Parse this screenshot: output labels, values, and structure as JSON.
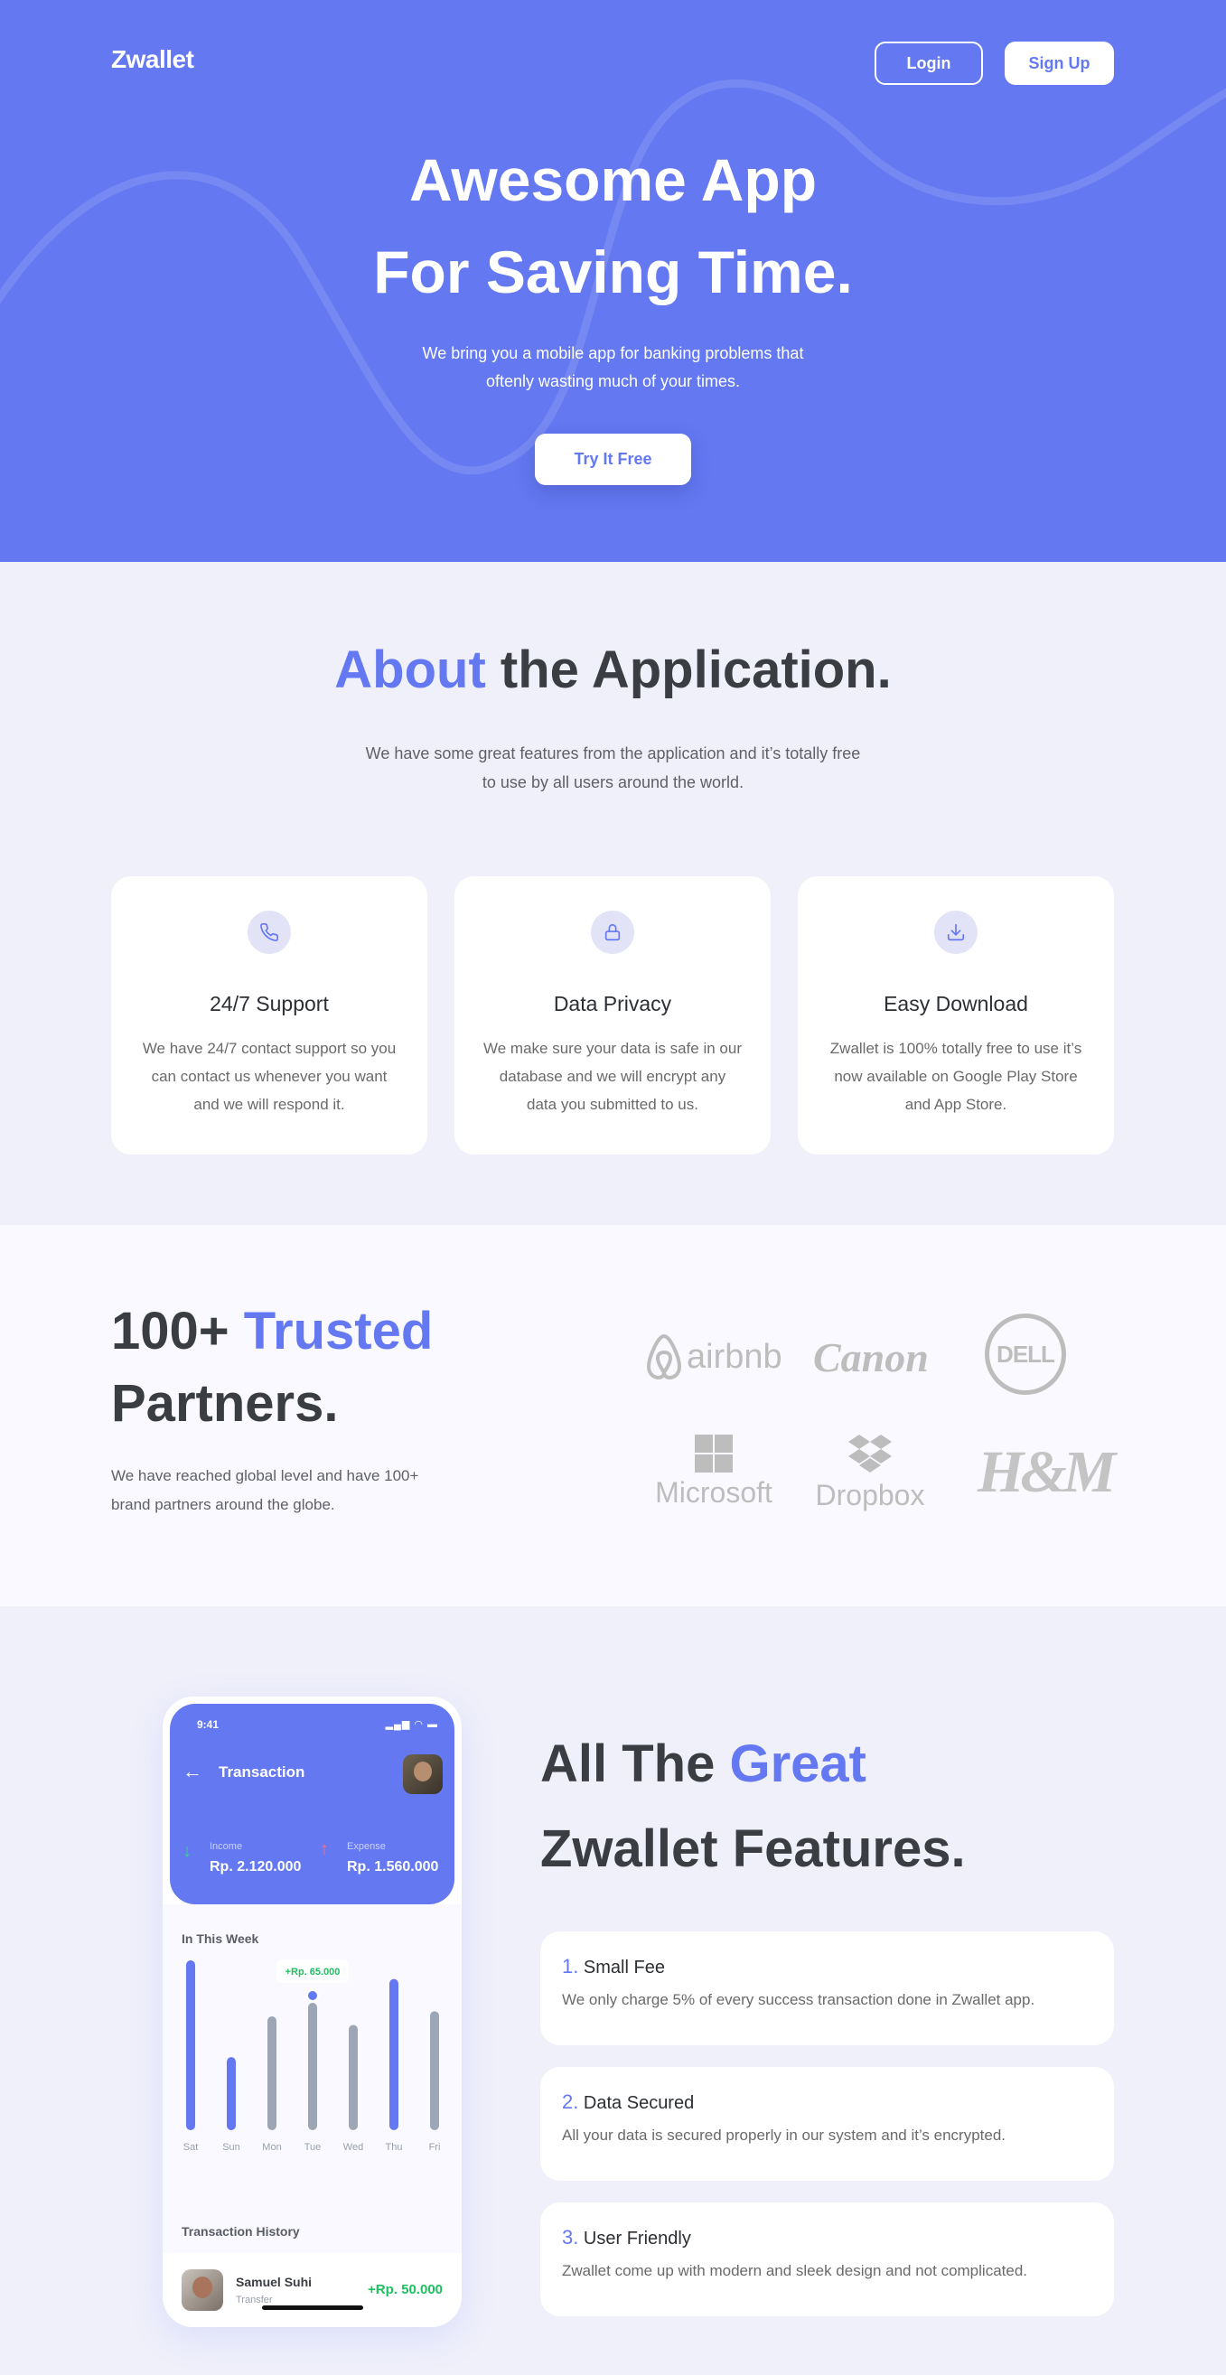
{
  "header": {
    "logo": "Zwallet",
    "login_label": "Login",
    "signup_label": "Sign Up"
  },
  "hero": {
    "title_line1": "Awesome App",
    "title_line2": "For Saving Time.",
    "subtitle_line1": "We bring you a mobile app for banking problems that",
    "subtitle_line2": "oftenly wasting much of your times.",
    "cta_label": "Try It Free"
  },
  "about": {
    "title_accent": "About",
    "title_rest": " the Application.",
    "desc_line1": "We have some great features from the application and it’s totally free",
    "desc_line2": "to use by all users around the world.",
    "cards": [
      {
        "icon": "phone-icon",
        "title": "24/7 Support",
        "lines": [
          "We have 24/7 contact support so you",
          "can contact us whenever you want",
          "and we will respond it."
        ]
      },
      {
        "icon": "lock-icon",
        "title": "Data Privacy",
        "lines": [
          "We make sure your data is safe in our",
          "database and we will encrypt any",
          "data you submitted to us."
        ]
      },
      {
        "icon": "download-icon",
        "title": "Easy Download",
        "lines": [
          "Zwallet is 100% totally free to use it’s",
          "now available on Google Play Store",
          "and App Store."
        ]
      }
    ]
  },
  "partners": {
    "title_pre": "100+ ",
    "title_accent": "Trusted",
    "title_line2": "Partners.",
    "desc_line1": "We have reached global level and have 100+",
    "desc_line2": "brand partners around the globe.",
    "logos": [
      "airbnb",
      "Canon",
      "DELL",
      "Microsoft",
      "Dropbox",
      "H&M"
    ]
  },
  "phone": {
    "time": "9:41",
    "title": "Transaction",
    "income_label": "Income",
    "income_value": "Rp. 2.120.000",
    "expense_label": "Expense",
    "expense_value": "Rp. 1.560.000",
    "week_title": "In This Week",
    "tooltip": "+Rp. 65.000",
    "history_title": "Transaction History",
    "history_name": "Samuel Suhi",
    "history_sub": "Transfer",
    "history_amount": "+Rp. 50.000"
  },
  "chart_data": {
    "type": "bar",
    "categories": [
      "Sat",
      "Sun",
      "Mon",
      "Tue",
      "Wed",
      "Thu",
      "Fri"
    ],
    "values": [
      100,
      43,
      67,
      75,
      62,
      89,
      70
    ],
    "highlight": [
      "blue",
      "blue",
      "gray",
      "gray",
      "gray",
      "blue",
      "gray"
    ],
    "colors": {
      "blue": "#6378f1",
      "gray": "#9da6b5"
    },
    "ylim": [
      0,
      100
    ],
    "title": "In This Week",
    "xlabel": "",
    "ylabel": ""
  },
  "features": {
    "title_pre": "All The ",
    "title_accent": "Great",
    "title_line2": "Zwallet Features.",
    "items": [
      {
        "num": "1.",
        "title": "Small Fee",
        "desc": "We only charge 5% of every success transaction done in Zwallet app."
      },
      {
        "num": "2.",
        "title": "Data Secured",
        "desc": "All your data is secured properly in our system and it’s encrypted."
      },
      {
        "num": "3.",
        "title": "User Friendly",
        "desc": "Zwallet come up with modern and sleek design and not complicated."
      }
    ]
  },
  "colors": {
    "primary": "#6378f1",
    "dark_text": "#3a3d42",
    "bg_light": "#f0f0fb"
  }
}
